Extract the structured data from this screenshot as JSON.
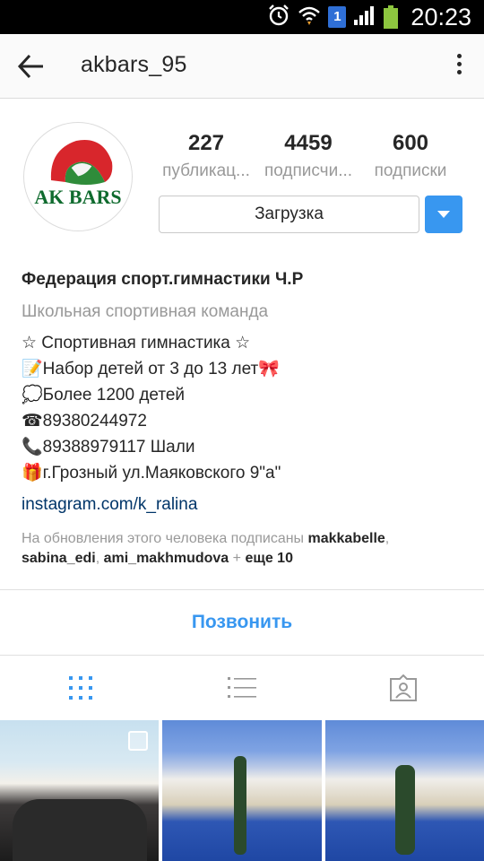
{
  "status_bar": {
    "time": "20:23",
    "notification_count": "1",
    "icons": [
      "alarm-icon",
      "wifi-icon",
      "notification-badge",
      "signal-icon",
      "battery-icon"
    ],
    "battery_color": "#8dc63f"
  },
  "header": {
    "username": "akbars_95",
    "back_icon": "arrow-left-icon",
    "menu_icon": "more-vertical-icon"
  },
  "profile": {
    "avatar_text": "AK BARS",
    "stats": [
      {
        "value": "227",
        "label": "публикац..."
      },
      {
        "value": "4459",
        "label": "подписчи..."
      },
      {
        "value": "600",
        "label": "подписки"
      }
    ],
    "follow_button": "Загрузка",
    "accent_color": "#3897f0"
  },
  "bio": {
    "name": "Федерация спорт.гимнастики Ч.Р",
    "category": "Школьная спортивная команда",
    "lines": [
      "☆ Спортивная гимнастика ☆",
      "📝Набор детей от 3 до 13 лет🎀",
      "💭Более 1200 детей",
      "☎89380244972",
      "📞89388979117 Шали",
      "🎁г.Грозный ул.Маяковского 9\"а\""
    ],
    "link": "instagram.com/k_ralina",
    "followed_prefix": "На обновления этого человека подписаны",
    "followed_users": [
      "makkabelle",
      "sabina_edi",
      "ami_makhmudova"
    ],
    "followed_more": "еще 10"
  },
  "actions": {
    "call_button": "Позвонить"
  },
  "tabs": [
    {
      "name": "grid-view",
      "icon": "grid-icon",
      "active": true
    },
    {
      "name": "list-view",
      "icon": "list-icon",
      "active": false
    },
    {
      "name": "tagged",
      "icon": "tagged-person-icon",
      "active": false
    }
  ]
}
